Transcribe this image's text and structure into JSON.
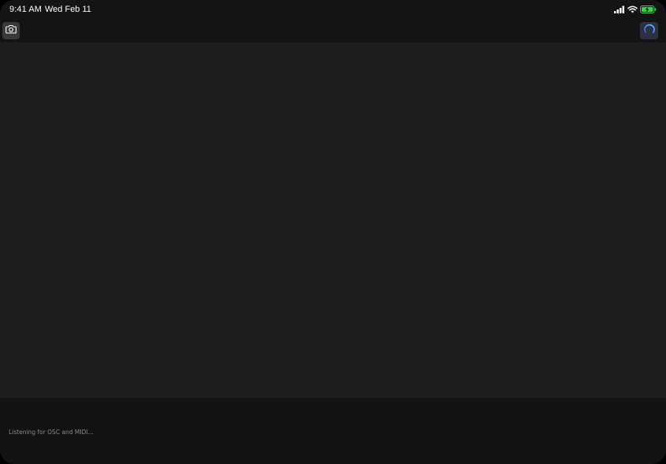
{
  "status_bar": {
    "time": "9:41 AM",
    "date": "Wed Feb 11",
    "icons": [
      "cellular-signal-icon",
      "wifi-icon",
      "battery-charging-icon"
    ],
    "battery_color": "#3fd14b"
  },
  "toolbar": {
    "left_icon": "camera-icon",
    "right_icon": "activity-ring-icon",
    "accent_color": "#4a8cff"
  },
  "console": {
    "message": "Listening for OSC and MIDI..."
  }
}
